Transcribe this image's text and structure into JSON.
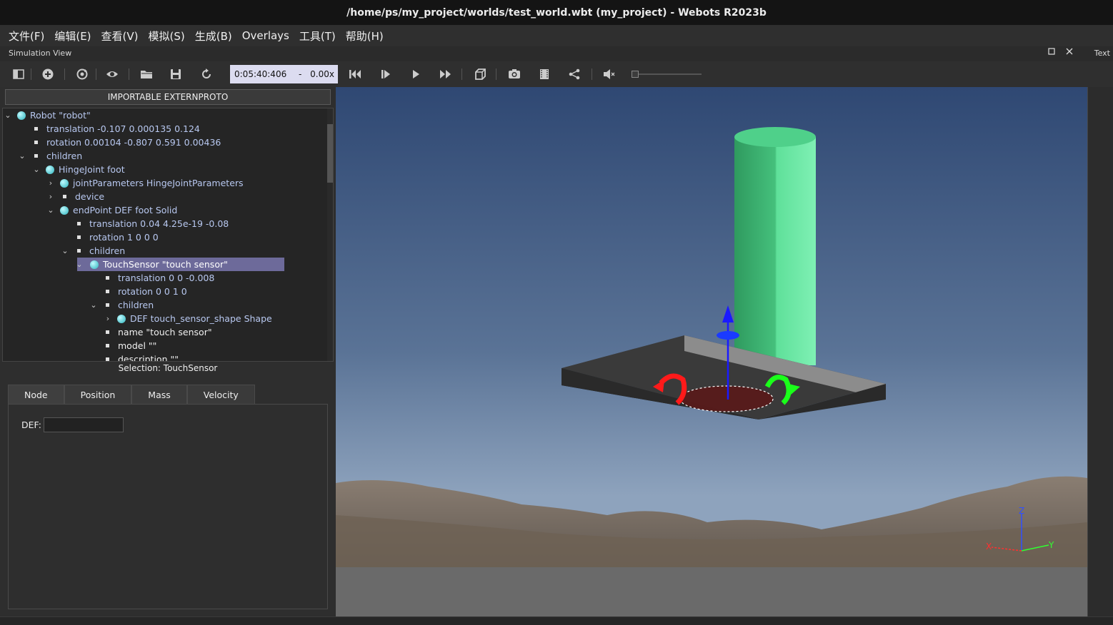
{
  "window": {
    "title": "/home/ps/my_project/worlds/test_world.wbt (my_project) - Webots R2023b"
  },
  "menu": [
    "文件(F)",
    "编辑(E)",
    "查看(V)",
    "模拟(S)",
    "生成(B)",
    "Overlays",
    "工具(T)",
    "帮助(H)"
  ],
  "panel": {
    "title": "Simulation View",
    "text_label": "Text",
    "maximize_icon": "square-icon",
    "close_icon": "close-icon"
  },
  "toolbar": {
    "time": "0:05:40:406",
    "dash": "-",
    "speed": "0.00x",
    "volume_level": 0
  },
  "scene_tree": {
    "extern_button": "IMPORTABLE EXTERNPROTO",
    "rows": [
      {
        "text": "Robot \"robot\"",
        "kind": "node",
        "expanded": true
      },
      {
        "text": "translation -0.107 0.000135 0.124",
        "kind": "field"
      },
      {
        "text": "rotation 0.00104 -0.807 0.591 0.00436",
        "kind": "field"
      },
      {
        "text": "children",
        "kind": "field",
        "expanded": true
      },
      {
        "text": "HingeJoint foot",
        "kind": "node",
        "expanded": true
      },
      {
        "text": "jointParameters HingeJointParameters",
        "kind": "node",
        "expanded": false
      },
      {
        "text": "device",
        "kind": "field",
        "expanded": false
      },
      {
        "text": "endPoint DEF foot Solid",
        "kind": "node",
        "expanded": true
      },
      {
        "text": "translation 0.04 4.25e-19 -0.08",
        "kind": "field"
      },
      {
        "text": "rotation 1 0 0 0",
        "kind": "field"
      },
      {
        "text": "children",
        "kind": "field",
        "expanded": true
      },
      {
        "text": "TouchSensor \"touch sensor\"",
        "kind": "node",
        "expanded": true,
        "selected": true
      },
      {
        "text": "translation 0 0 -0.008",
        "kind": "field"
      },
      {
        "text": "rotation 0 0 1 0",
        "kind": "field"
      },
      {
        "text": "children",
        "kind": "field",
        "expanded": true
      },
      {
        "text": "DEF touch_sensor_shape Shape",
        "kind": "node",
        "expanded": false
      },
      {
        "text": "name \"touch sensor\"",
        "kind": "field",
        "white": true
      },
      {
        "text": "model \"\"",
        "kind": "field",
        "white": true
      },
      {
        "text": "description \"\"",
        "kind": "field",
        "white": true
      }
    ]
  },
  "inspector": {
    "selection": "Selection: TouchSensor",
    "tabs": [
      "Node",
      "Position",
      "Mass",
      "Velocity"
    ],
    "active_tab": "Node",
    "def_label": "DEF:",
    "def_value": ""
  },
  "viewport": {
    "axes": {
      "z": "Z",
      "y": "Y",
      "x": "X"
    },
    "colors": {
      "cylinder": "#5fe09a",
      "sky_top": "#2f4873",
      "sky_bottom": "#8ea3bd",
      "ground": "#6a6a6a"
    }
  }
}
